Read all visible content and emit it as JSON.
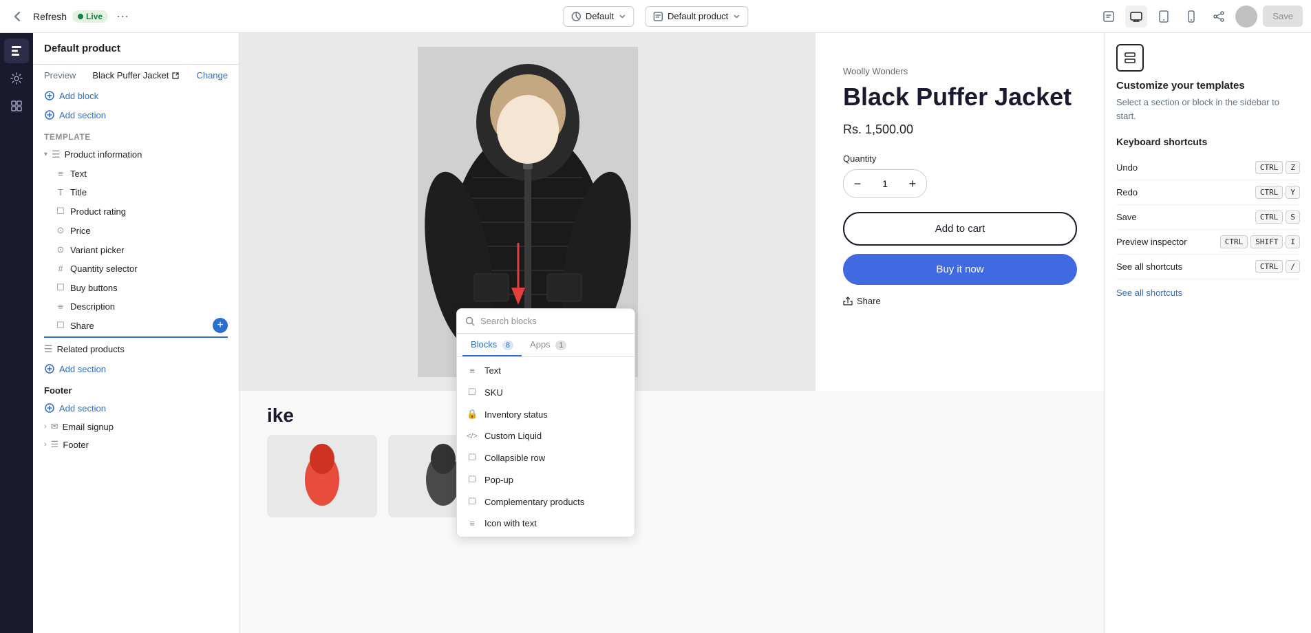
{
  "topbar": {
    "refresh_label": "Refresh",
    "live_label": "Live",
    "more_icon": "···",
    "default_theme": "Default",
    "default_product": "Default product",
    "save_label": "Save"
  },
  "left_panel": {
    "title": "Default product",
    "preview_label": "Preview",
    "preview_value": "Black Puffer Jacket",
    "preview_change": "Change",
    "add_block": "Add block",
    "add_section_top": "Add section",
    "template_label": "Template",
    "product_info": "Product information",
    "blocks": [
      {
        "label": "Text",
        "icon": "≡"
      },
      {
        "label": "Title",
        "icon": "T"
      },
      {
        "label": "Product rating",
        "icon": "☐"
      },
      {
        "label": "Price",
        "icon": "⊙"
      },
      {
        "label": "Variant picker",
        "icon": "⊙"
      },
      {
        "label": "Quantity selector",
        "icon": "#"
      },
      {
        "label": "Buy buttons",
        "icon": "☐"
      },
      {
        "label": "Description",
        "icon": "≡"
      },
      {
        "label": "Share",
        "icon": "☐"
      }
    ],
    "related_products": "Related products",
    "add_section_bottom": "Add section",
    "footer_label": "Footer",
    "add_section_footer": "Add section",
    "footer_items": [
      "Email signup",
      "Footer"
    ]
  },
  "block_search": {
    "placeholder": "Search blocks",
    "tabs": [
      {
        "label": "Blocks",
        "count": "8"
      },
      {
        "label": "Apps",
        "count": "1"
      }
    ],
    "items": [
      {
        "label": "Text",
        "icon": "≡"
      },
      {
        "label": "SKU",
        "icon": "☐"
      },
      {
        "label": "Inventory status",
        "icon": "🔒"
      },
      {
        "label": "Custom Liquid",
        "icon": "</>"
      },
      {
        "label": "Collapsible row",
        "icon": "☐"
      },
      {
        "label": "Pop-up",
        "icon": "☐"
      },
      {
        "label": "Complementary products",
        "icon": "☐"
      },
      {
        "label": "Icon with text",
        "icon": "≡"
      }
    ]
  },
  "product": {
    "brand": "Woolly Wonders",
    "title": "Black Puffer Jacket",
    "price": "Rs. 1,500.00",
    "quantity_label": "Quantity",
    "quantity_value": "1",
    "add_to_cart": "Add to cart",
    "buy_now": "Buy it now",
    "share": "Share"
  },
  "right_panel": {
    "title": "Customize your templates",
    "description": "Select a section or block in the sidebar to start.",
    "shortcuts_title": "Keyboard shortcuts",
    "shortcuts": [
      {
        "label": "Undo",
        "keys": [
          "CTRL",
          "Z"
        ]
      },
      {
        "label": "Redo",
        "keys": [
          "CTRL",
          "Y"
        ]
      },
      {
        "label": "Save",
        "keys": [
          "CTRL",
          "S"
        ]
      },
      {
        "label": "Preview inspector",
        "keys": [
          "CTRL",
          "SHIFT",
          "I"
        ]
      },
      {
        "label": "See all shortcuts",
        "keys": [
          "CTRL",
          "/"
        ]
      }
    ]
  }
}
